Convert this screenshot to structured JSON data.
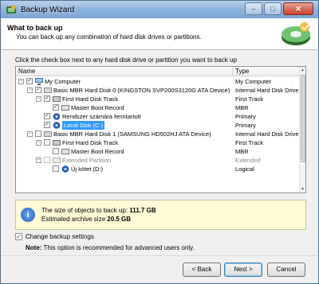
{
  "window": {
    "title": "Backup Wizard",
    "controls": {
      "minimize": "–",
      "maximize": "□",
      "close": "✕"
    }
  },
  "header": {
    "title": "What to back up",
    "subtitle": "You can back up any combination of hard disk drives or partitions."
  },
  "instruction": "Click the check box next to any hard disk drive or partition you want to back up",
  "tree": {
    "columns": {
      "name": "Name",
      "type": "Type"
    },
    "rows": [
      {
        "name": "My Computer",
        "type": "My Computer"
      },
      {
        "name": "Basic MBR Hard Disk 0 (KINGSTON SVP200S3120G ATA Device)",
        "type": "Internal Hard Disk Drive"
      },
      {
        "name": "First Hard Disk Track",
        "type": "First Track"
      },
      {
        "name": "Master Boot Record",
        "type": "MBR"
      },
      {
        "name": "Rendszer számára fenntartott",
        "type": "Primary"
      },
      {
        "name": "Local Disk (C:)",
        "type": "Primary"
      },
      {
        "name": "Basic MBR Hard Disk 1 (SAMSUNG HD502HJ ATA Device)",
        "type": "Internal Hard Disk Drive"
      },
      {
        "name": "First Hard Disk Track",
        "type": "First Track"
      },
      {
        "name": "Master Boot Record",
        "type": "MBR"
      },
      {
        "name": "Extended Partition",
        "type": "Extended"
      },
      {
        "name": "Új kötet (D:)",
        "type": "Logical"
      }
    ]
  },
  "info": {
    "size_label": "The size of objects to back up:",
    "size_value": "111.7 GB",
    "archive_label": "Estimated archive size",
    "archive_value": "20.5 GB"
  },
  "change_settings_label": "Change backup settings",
  "note": {
    "label": "Note:",
    "text": "This option is recommended for advanced users only."
  },
  "buttons": {
    "back": "< Back",
    "next": "Next >",
    "cancel": "Cancel"
  }
}
